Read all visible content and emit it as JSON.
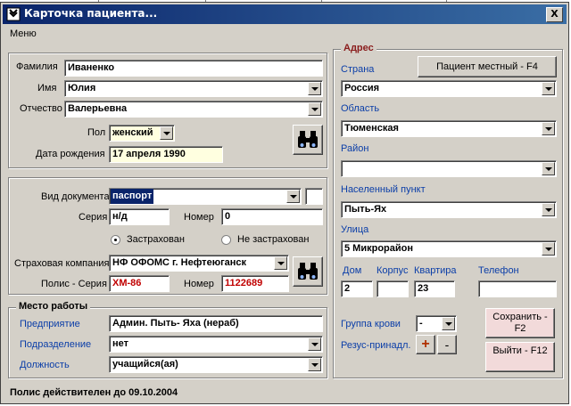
{
  "window": {
    "title": "Карточка пациента...",
    "close_label": "X"
  },
  "menu": {
    "label": "Меню"
  },
  "person": {
    "surname_label": "Фамилия",
    "surname": "Иваненко",
    "name_label": "Имя",
    "name": "Юлия",
    "patronymic_label": "Отчество",
    "patronymic": "Валерьевна",
    "sex_label": "Пол",
    "sex": "женский",
    "dob_label": "Дата рождения",
    "dob": "17 апреля 1990"
  },
  "document": {
    "type_label": "Вид документа",
    "type": "паспорт",
    "series_label": "Серия",
    "series": "н/д",
    "number_label": "Номер",
    "number": "0",
    "insured_label": "Застрахован",
    "not_insured_label": "Не застрахован",
    "insurer_label": "Страховая компания",
    "insurer": "НФ ОФОМС г. Нефтеюганск",
    "policy_series_label": "Полис - Серия",
    "policy_series": "ХМ-86",
    "policy_number_label": "Номер",
    "policy_number": "1122689"
  },
  "work": {
    "legend": "Место работы",
    "enterprise_label": "Предприятие",
    "enterprise": "Админ. Пыть- Яха (нераб)",
    "department_label": "Подразделение",
    "department": "нет",
    "position_label": "Должность",
    "position": "учащийся(ая)"
  },
  "address": {
    "legend": "Адрес",
    "local_button": "Пациент местный - F4",
    "country_label": "Страна",
    "country": "Россия",
    "region_label": "Область",
    "region": "Тюменская",
    "district_label": "Район",
    "district": "",
    "locality_label": "Населенный пункт",
    "locality": "Пыть-Ях",
    "street_label": "Улица",
    "street": "5 Микрорайон",
    "house_label": "Дом",
    "house": "2",
    "building_label": "Корпус",
    "building": "",
    "flat_label": "Квартира",
    "flat": "23",
    "phone_label": "Телефон",
    "phone": ""
  },
  "blood": {
    "group_label": "Группа крови",
    "group": "-",
    "rh_label": "Резус-принадл.",
    "rh_plus": "+",
    "rh_minus": "-"
  },
  "buttons": {
    "save": "Сохранить - F2",
    "exit": "Выйти - F12"
  },
  "status": {
    "text": "Полис действителен до 09.10.2004"
  },
  "colors": {
    "title_start": "#0a246a",
    "title_end": "#3a6ea5",
    "dialog": "#d4d0c8",
    "label_blue": "#0b3ea8",
    "policy_red": "#c00000",
    "dob_fill": "#ffffe0"
  }
}
